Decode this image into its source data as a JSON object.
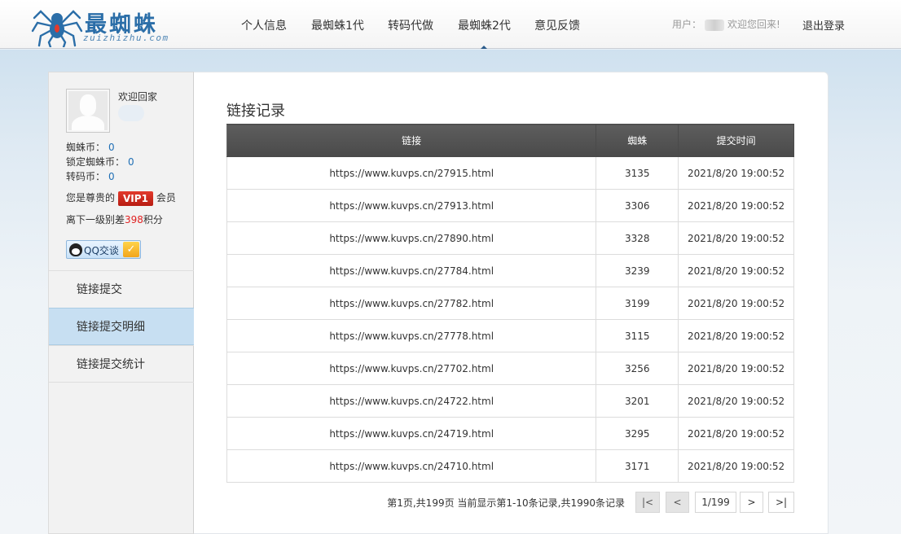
{
  "header": {
    "logo_cn": "最蜘蛛",
    "logo_en": "zuizhizhu.com",
    "nav": [
      "个人信息",
      "最蜘蛛1代",
      "转码代做",
      "最蜘蛛2代",
      "意见反馈"
    ],
    "active_nav": "最蜘蛛2代",
    "user_prefix": "用户：",
    "welcome_back": "欢迎您回来!",
    "logout": "退出登录"
  },
  "sidebar": {
    "welcome": "欢迎回家",
    "stats": [
      {
        "label": "蜘蛛币：",
        "value": "0"
      },
      {
        "label": "锁定蜘蛛币：",
        "value": "0"
      },
      {
        "label": "转码币：",
        "value": "0"
      }
    ],
    "vip_prefix": "您是尊贵的",
    "vip_badge": "VIP1",
    "vip_suffix": "会员",
    "next_prefix": "离下一级别差",
    "next_value": "398",
    "next_suffix": "积分",
    "qq_label": "QQ交谈",
    "menu": [
      "链接提交",
      "链接提交明细",
      "链接提交统计"
    ],
    "active_menu": "链接提交明细"
  },
  "main": {
    "title": "链接记录",
    "columns": [
      "链接",
      "蜘蛛",
      "提交时间"
    ],
    "rows": [
      {
        "link": "https://www.kuvps.cn/27915.html",
        "spiders": "3135",
        "time": "2021/8/20 19:00:52"
      },
      {
        "link": "https://www.kuvps.cn/27913.html",
        "spiders": "3306",
        "time": "2021/8/20 19:00:52"
      },
      {
        "link": "https://www.kuvps.cn/27890.html",
        "spiders": "3328",
        "time": "2021/8/20 19:00:52"
      },
      {
        "link": "https://www.kuvps.cn/27784.html",
        "spiders": "3239",
        "time": "2021/8/20 19:00:52"
      },
      {
        "link": "https://www.kuvps.cn/27782.html",
        "spiders": "3199",
        "time": "2021/8/20 19:00:52"
      },
      {
        "link": "https://www.kuvps.cn/27778.html",
        "spiders": "3115",
        "time": "2021/8/20 19:00:52"
      },
      {
        "link": "https://www.kuvps.cn/27702.html",
        "spiders": "3256",
        "time": "2021/8/20 19:00:52"
      },
      {
        "link": "https://www.kuvps.cn/24722.html",
        "spiders": "3201",
        "time": "2021/8/20 19:00:52"
      },
      {
        "link": "https://www.kuvps.cn/24719.html",
        "spiders": "3295",
        "time": "2021/8/20 19:00:52"
      },
      {
        "link": "https://www.kuvps.cn/24710.html",
        "spiders": "3171",
        "time": "2021/8/20 19:00:52"
      }
    ],
    "pager": {
      "info": "第1页,共199页 当前显示第1-10条记录,共1990条记录",
      "first": "|<",
      "prev": "<",
      "current": "1/199",
      "next": ">",
      "last": ">|"
    }
  },
  "colors": {
    "brand_blue": "#2b6ea8",
    "link_blue": "#1f6fb5",
    "vip_red": "#d32a1e",
    "table_header": "#555555",
    "active_menu_bg": "#c7dff2"
  },
  "icons": [
    "spider-logo-icon",
    "qq-penguin-icon",
    "check-badge-icon",
    "default-avatar-icon"
  ]
}
